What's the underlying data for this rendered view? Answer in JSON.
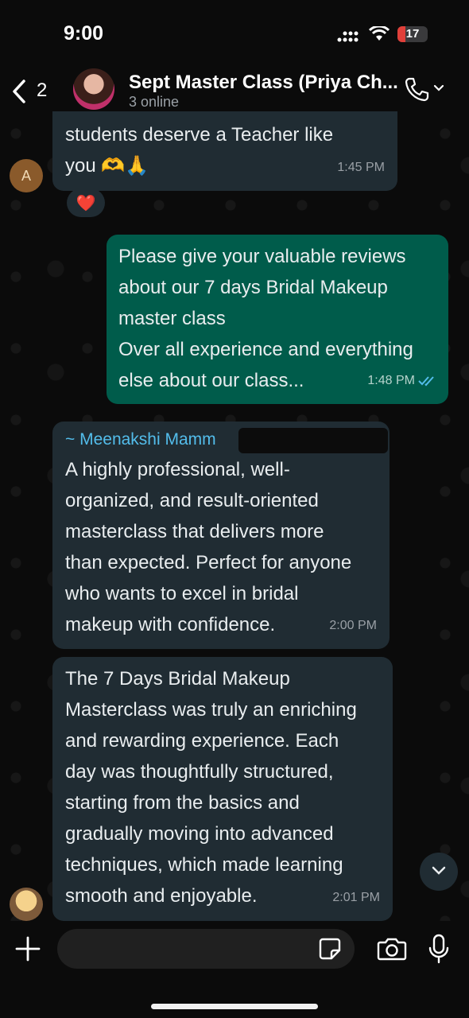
{
  "status_bar": {
    "time": "9:00",
    "battery_level": "17"
  },
  "header": {
    "back_count": "2",
    "group_name": "Sept Master Class (Priya Ch...",
    "subtitle": "3 online"
  },
  "messages": [
    {
      "direction": "incoming",
      "text": "students deserve a Teacher like\nyou 🫶🙏",
      "time": "1:45 PM",
      "sender_initial": "A",
      "reaction": "❤️"
    },
    {
      "direction": "outgoing",
      "text": "Please give your valuable reviews\nabout our 7 days Bridal Makeup\nmaster class\nOver all experience and everything\nelse about our class...",
      "time": "1:48 PM",
      "read": true
    },
    {
      "direction": "incoming",
      "sender": "~ Meenakshi Mamm",
      "text": "A highly professional, well-\norganized, and result-oriented\nmasterclass that delivers more\nthan expected. Perfect for anyone\nwho wants to excel in bridal\nmakeup with confidence.",
      "time": "2:00 PM"
    },
    {
      "direction": "incoming",
      "text": "The 7 Days Bridal Makeup\nMasterclass was truly an enriching\nand rewarding experience. Each\nday was thoughtfully structured,\nstarting from the basics and\ngradually moving into advanced\ntechniques, which made learning\nsmooth and enjoyable.",
      "time": "2:01 PM"
    }
  ],
  "composer": {
    "placeholder": ""
  },
  "icons": [
    "back-chevron-icon",
    "voice-call-icon",
    "chevron-down-icon",
    "plus-icon",
    "sticker-icon",
    "camera-icon",
    "microphone-icon",
    "double-check-icon"
  ],
  "colors": {
    "incoming_bubble": "#202c33",
    "outgoing_bubble": "#005c4b",
    "sender_name": "#53bdeb",
    "read_ticks": "#53bdeb"
  }
}
